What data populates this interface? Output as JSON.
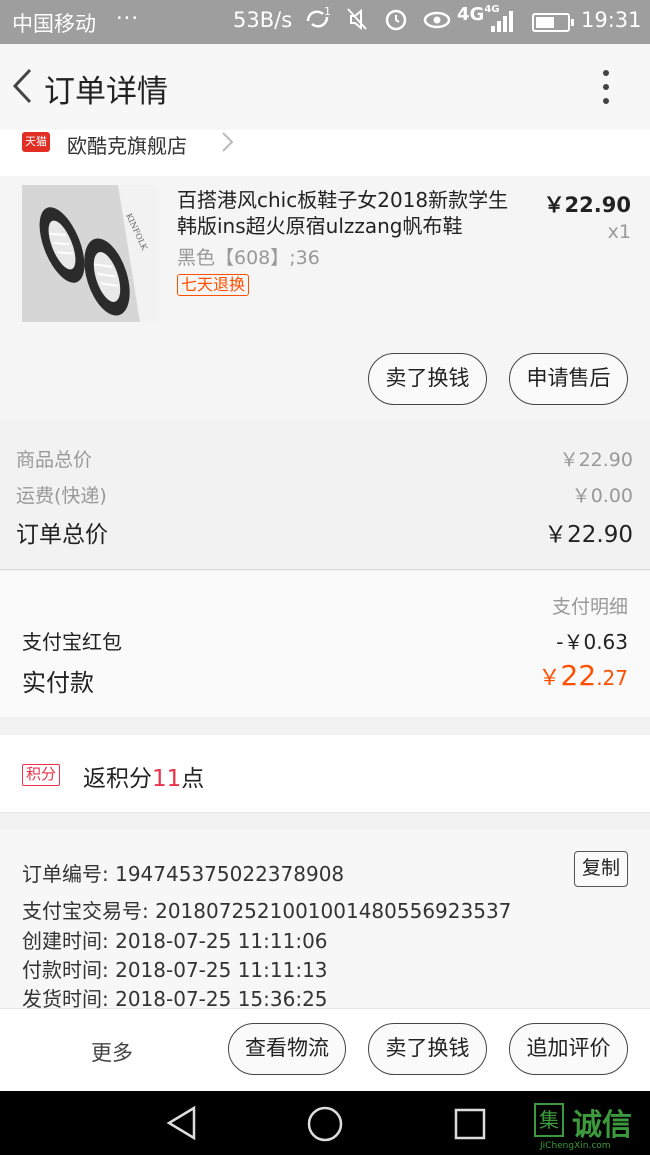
{
  "status_bar": {
    "carrier": "中国移动",
    "dots": "···",
    "net_speed": "53B/s",
    "sim_superscript": "1",
    "network_type": "4G",
    "network_type_small": "4G",
    "time": "19:31",
    "battery_level": 0.6,
    "icons": [
      "sync-icon",
      "mute-icon",
      "alarm-icon",
      "eye-icon",
      "signal-icon",
      "battery-icon"
    ]
  },
  "header": {
    "title": "订单详情"
  },
  "shop": {
    "badge": "天猫",
    "name": "欧酷克旗舰店"
  },
  "product": {
    "name": "百搭港风chic板鞋子女2018新款学生韩版ins超火原宿ulzzang帆布鞋",
    "variant": "黑色【608】;36",
    "tag": "七天退换",
    "price": "￥22.90",
    "quantity": "x1",
    "thumbnail_text": "KINFOLK",
    "buttons": [
      "卖了换钱",
      "申请售后"
    ]
  },
  "summary": {
    "goods_label": "商品总价",
    "goods_value": "￥22.90",
    "shipping_label": "运费(快递)",
    "shipping_value": "￥0.00",
    "total_label": "订单总价",
    "total_value": "￥22.90"
  },
  "payment": {
    "detail_link": "支付明细",
    "redpacket_label": "支付宝红包",
    "redpacket_value": "-￥0.63",
    "paid_label": "实付款",
    "paid_currency": "￥",
    "paid_int": "22",
    "paid_dec": ".27"
  },
  "points": {
    "badge": "积分",
    "prefix": "返积分",
    "count": "11",
    "suffix": "点"
  },
  "order_info": {
    "order_no_label": "订单编号:",
    "order_no": "194745375022378908",
    "copy_label": "复制",
    "alipay_label": "支付宝交易号:",
    "alipay_no": "2018072521001001480556923537",
    "created_label": "创建时间:",
    "created_time": "2018-07-25 11:11:06",
    "paid_label": "付款时间:",
    "paid_time": "2018-07-25 11:11:13",
    "shipped_label": "发货时间:",
    "shipped_time": "2018-07-25 15:36:25"
  },
  "action_bar": {
    "more": "更多",
    "logistics": "查看物流",
    "resell": "卖了换钱",
    "review": "追加评价"
  },
  "watermark": {
    "icon_char": "集",
    "text": "诚信",
    "url": "JiChengXin.com"
  },
  "colors": {
    "accent": "#ff5000",
    "points_red": "#e8334a",
    "tmall_red": "#e02e24"
  }
}
